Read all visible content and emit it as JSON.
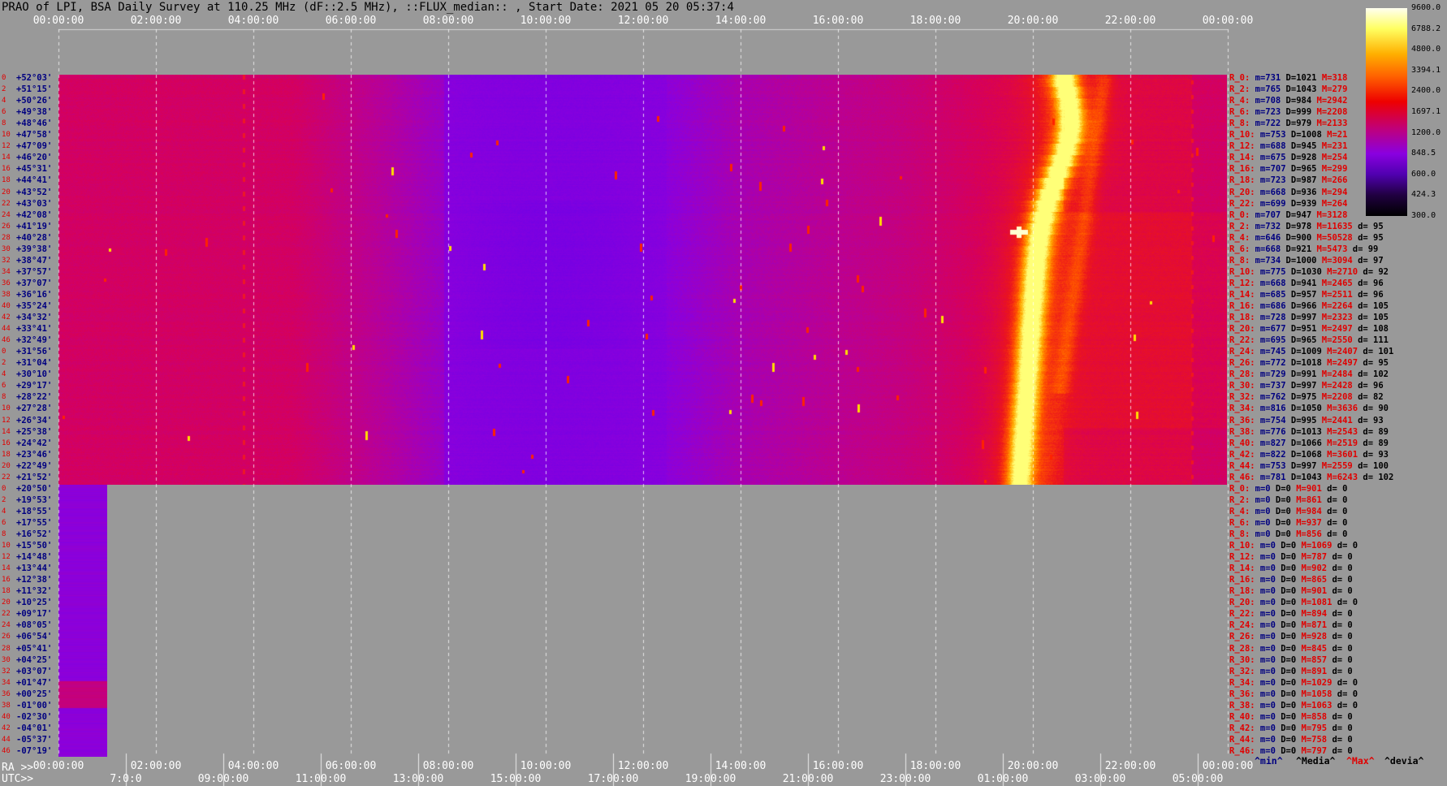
{
  "header": {
    "title": "PRAO of LPI, BSA Daily Survey at 110.25 MHz (dF::2.5 MHz), ::FLUX_median:: , Start Date: 2021 05 20 05:37:4"
  },
  "time_axis": {
    "top_labels": [
      "00:00:00",
      "02:00:00",
      "04:00:00",
      "06:00:00",
      "08:00:00",
      "10:00:00",
      "12:00:00",
      "14:00:00",
      "16:00:00",
      "18:00:00",
      "20:00:00",
      "22:00:00",
      "00:00:00"
    ],
    "bottom_ra_prefix": "RA >>",
    "bottom_ra_labels": [
      "00:00:00",
      "02:00:00",
      "04:00:00",
      "06:00:00",
      "08:00:00",
      "10:00:00",
      "12:00:00",
      "14:00:00",
      "16:00:00",
      "18:00:00",
      "20:00:00",
      "22:00:00",
      "00:00:00"
    ],
    "bottom_utc_prefix": "UTC>>",
    "bottom_utc_labels": [
      "7:0:0",
      "09:00:00",
      "11:00:00",
      "13:00:00",
      "15:00:00",
      "17:00:00",
      "19:00:00",
      "21:00:00",
      "23:00:00",
      "01:00:00",
      "03:00:00",
      "05:00:00"
    ]
  },
  "declinations": [
    "+52°03'",
    "+51°15'",
    "+50°26'",
    "+49°38'",
    "+48°46'",
    "+47°58'",
    "+47°09'",
    "+46°20'",
    "+45°31'",
    "+44°41'",
    "+43°52'",
    "+43°03'",
    "+42°08'",
    "+41°19'",
    "+40°28'",
    "+39°38'",
    "+38°47'",
    "+37°57'",
    "+37°07'",
    "+36°16'",
    "+35°24'",
    "+34°32'",
    "+33°41'",
    "+32°49'",
    "+31°56'",
    "+31°04'",
    "+30°10'",
    "+29°17'",
    "+28°22'",
    "+27°28'",
    "+26°34'",
    "+25°38'",
    "+24°42'",
    "+23°46'",
    "+22°49'",
    "+21°52'",
    "+20°50'",
    "+19°53'",
    "+18°55'",
    "+17°55'",
    "+16°52'",
    "+15°50'",
    "+14°48'",
    "+13°44'",
    "+12°38'",
    "+11°32'",
    "+10°25'",
    "+09°17'",
    "+08°05'",
    "+06°54'",
    "+05°41'",
    "+04°25'",
    "+03°07'",
    "+01°47'",
    "+00°25'",
    "-01°00'",
    "-02°30'",
    "-04°01'",
    "-05°37'",
    "-07°19'"
  ],
  "stats_rows": [
    "R_0: m=731 D=1021 M=318",
    "R_2: m=765 D=1043 M=279",
    "R_4: m=708 D=984 M=2942",
    "R_6: m=723 D=999 M=2208",
    "R_8: m=722 D=979 M=2133",
    "R_10: m=753 D=1008 M=21",
    "R_12: m=688 D=945 M=231",
    "R_14: m=675 D=928 M=254",
    "R_16: m=707 D=965 M=299",
    "R_18: m=723 D=987 M=266",
    "R_20: m=668 D=936 M=294",
    "R_22: m=699 D=939 M=264",
    "R_0: m=707 D=947 M=3128",
    "R_2: m=732 D=978 M=11635 d= 95",
    "R_4: m=646 D=900 M=50528 d= 95",
    "R_6: m=668 D=921 M=5473 d= 99",
    "R_8: m=734 D=1000 M=3094 d= 97",
    "R_10: m=775 D=1030 M=2710 d= 92",
    "R_12: m=668 D=941 M=2465 d= 96",
    "R_14: m=685 D=957 M=2511 d= 96",
    "R_16: m=686 D=966 M=2264 d= 105",
    "R_18: m=728 D=997 M=2323 d= 105",
    "R_20: m=677 D=951 M=2497 d= 108",
    "R_22: m=695 D=965 M=2550 d= 111",
    "R_24: m=745 D=1009 M=2407 d= 101",
    "R_26: m=772 D=1018 M=2497 d= 95",
    "R_28: m=729 D=991 M=2484 d= 102",
    "R_30: m=737 D=997 M=2428 d= 96",
    "R_32: m=762 D=975 M=2208 d= 82",
    "R_34: m=816 D=1050 M=3636 d= 90",
    "R_36: m=754 D=995 M=2441 d= 93",
    "R_38: m=776 D=1013 M=2543 d= 89",
    "R_40: m=827 D=1066 M=2519 d= 89",
    "R_42: m=822 D=1068 M=3601 d= 93",
    "R_44: m=753 D=997 M=2559 d= 100",
    "R_46: m=781 D=1043 M=6243 d= 102",
    "R_0: m=0 D=0 M=901 d= 0",
    "R_2: m=0 D=0 M=861 d= 0",
    "R_4: m=0 D=0 M=984 d= 0",
    "R_6: m=0 D=0 M=937 d= 0",
    "R_8: m=0 D=0 M=856 d= 0",
    "R_10: m=0 D=0 M=1069 d= 0",
    "R_12: m=0 D=0 M=787 d= 0",
    "R_14: m=0 D=0 M=902 d= 0",
    "R_16: m=0 D=0 M=865 d= 0",
    "R_18: m=0 D=0 M=901 d= 0",
    "R_20: m=0 D=0 M=1081 d= 0",
    "R_22: m=0 D=0 M=894 d= 0",
    "R_24: m=0 D=0 M=871 d= 0",
    "R_26: m=0 D=0 M=928 d= 0",
    "R_28: m=0 D=0 M=845 d= 0",
    "R_30: m=0 D=0 M=857 d= 0",
    "R_32: m=0 D=0 M=891 d= 0",
    "R_34: m=0 D=0 M=1029 d= 0",
    "R_36: m=0 D=0 M=1058 d= 0",
    "R_38: m=0 D=0 M=1063 d= 0",
    "R_40: m=0 D=0 M=858 d= 0",
    "R_42: m=0 D=0 M=795 d= 0",
    "R_44: m=0 D=0 M=758 d= 0",
    "R_46: m=0 D=0 M=797 d= 0"
  ],
  "colorbar": {
    "labels": [
      "9600.0",
      "6788.2",
      "4800.0",
      "3394.1",
      "2400.0",
      "1697.1",
      "1200.0",
      "848.5",
      "600.0",
      "424.3",
      "300.0"
    ]
  },
  "legend": {
    "min": "^min^",
    "median": "^Media^",
    "max": "^Max^",
    "devia": "^devia^"
  },
  "colors": {
    "background": "#999999",
    "purple": "#8a00e0",
    "magenta": "#c0007a",
    "red": "#e00000",
    "orange": "#ff8000",
    "yellow": "#ffff60",
    "label_red": "#e00000",
    "label_navy": "#000080"
  }
}
